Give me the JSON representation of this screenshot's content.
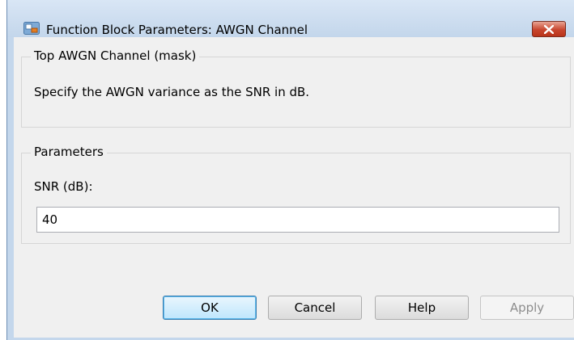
{
  "window": {
    "title": "Function Block Parameters: AWGN Channel"
  },
  "description_group": {
    "legend": "Top AWGN Channel (mask)",
    "text": "Specify the AWGN variance as the SNR in dB."
  },
  "parameters_group": {
    "legend": "Parameters",
    "snr_label": "SNR (dB):",
    "snr_value": "40"
  },
  "buttons": {
    "ok": "OK",
    "cancel": "Cancel",
    "help": "Help",
    "apply": "Apply"
  },
  "colors": {
    "title_bar": "#c4d7ec",
    "close_button": "#c8452d",
    "dialog_background": "#f0f0f0",
    "default_button_border": "#3c7fb1"
  }
}
